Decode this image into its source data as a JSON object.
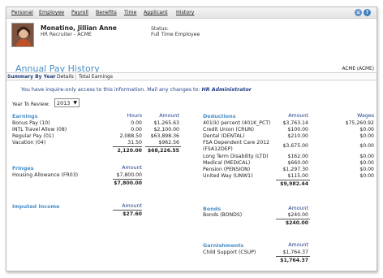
{
  "menu": [
    "Personal",
    "Employee",
    "Payroll",
    "Benefits",
    "Time",
    "Applicant",
    "History"
  ],
  "icons": {
    "list": "list-icon",
    "help": "help-icon"
  },
  "colors": {
    "accent": "#4a90c8",
    "link": "#1f3f8a",
    "icon_list": "#5a8fc8",
    "icon_help": "#3f7fbf"
  },
  "employee": {
    "name": "Monatino, Jillian Anne",
    "role": "HR Recruiter - ACME",
    "status_label": "Status:",
    "status_value": "Full Time Employee"
  },
  "page": {
    "title": "Annual Pay History",
    "company": "ACME (ACME)"
  },
  "tabs": [
    "Summary By Year",
    "Details",
    "Total Earnings"
  ],
  "notice": {
    "text": "You have inquire-only access to this information. Mail any changes to: ",
    "contact": "HR Administrator"
  },
  "year": {
    "label": "Year To Review:",
    "value": "2013"
  },
  "earnings": {
    "title": "Earnings",
    "col_hours": "Hours",
    "col_amount": "Amount",
    "rows": [
      {
        "name": "Bonus Pay (10)",
        "hours": "0.00",
        "amount": "$1,265.63"
      },
      {
        "name": "INTL Travel Allow (08)",
        "hours": "0.00",
        "amount": "$2,100.00"
      },
      {
        "name": "Regular Pay (01)",
        "hours": "2,088.50",
        "amount": "$63,898.36"
      },
      {
        "name": "Vacation (04)",
        "hours": "31.50",
        "amount": "$962.56"
      }
    ],
    "total_hours": "2,120.00",
    "total_amount": "$68,226.55"
  },
  "fringes": {
    "title": "Fringes",
    "col_amount": "Amount",
    "rows": [
      {
        "name": "Housing Allowance (FR03)",
        "amount": "$7,800.00"
      }
    ],
    "total": "$7,800.00"
  },
  "imputed": {
    "title": "Imputed Income",
    "col_amount": "Amount",
    "total": "$27.60"
  },
  "deductions": {
    "title": "Deductions",
    "col_amount": "Amount",
    "col_wages": "Wages",
    "rows": [
      {
        "name": "401(k) percent (401K_PCT)",
        "amount": "$3,763.14",
        "wages": "$75,260.92"
      },
      {
        "name": "Credit Union (CRUN)",
        "amount": "$100.00",
        "wages": "$0.00"
      },
      {
        "name": "Dental (DENTAL)",
        "amount": "$210.00",
        "wages": "$0.00"
      },
      {
        "name": "FSA Dependent Care 2012",
        "name2": "(FSA12DEP)",
        "amount": "$3,675.00",
        "wages": "$0.00"
      },
      {
        "name": "Long Term Disability (LTD)",
        "amount": "$162.00",
        "wages": "$0.00"
      },
      {
        "name": "Medical (MEDICAL)",
        "amount": "$660.00",
        "wages": "$0.00"
      },
      {
        "name": "Pension (PENSION)",
        "amount": "$1,297.30",
        "wages": "$0.00"
      },
      {
        "name": "United Way (UNW1)",
        "amount": "$115.00",
        "wages": "$0.00"
      }
    ],
    "total": "$9,982.44"
  },
  "bonds": {
    "title": "Bonds",
    "col_amount": "Amount",
    "rows": [
      {
        "name": "Bonds (BONDS)",
        "amount": "$240.00"
      }
    ],
    "total": "$240.00"
  },
  "garnishments": {
    "title": "Garnishments",
    "col_amount": "Amount",
    "rows": [
      {
        "name": "Child Support (CSUP)",
        "amount": "$1,764.37"
      }
    ],
    "total": "$1,764.37"
  }
}
